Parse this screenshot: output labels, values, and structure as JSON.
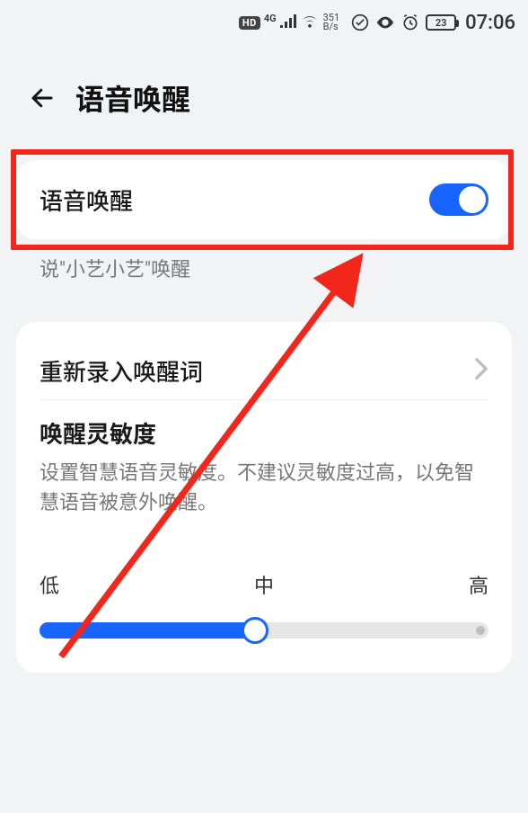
{
  "status_bar": {
    "hd": "HD",
    "net_gen": "4G",
    "speed_top": "351",
    "speed_unit": "B/s",
    "battery_pct": "23",
    "clock": "07:06"
  },
  "header": {
    "title": "语音唤醒"
  },
  "toggle_card": {
    "label": "语音唤醒",
    "enabled": true
  },
  "subcaption": "说\"小艺小艺\"唤醒",
  "sensitivity_card": {
    "rerecord_label": "重新录入唤醒词",
    "title": "唤醒灵敏度",
    "description": "设置智慧语音灵敏度。不建议灵敏度过高，以免智慧语音被意外唤醒。",
    "slider": {
      "low": "低",
      "mid": "中",
      "high": "高",
      "value_pct": 48
    }
  }
}
